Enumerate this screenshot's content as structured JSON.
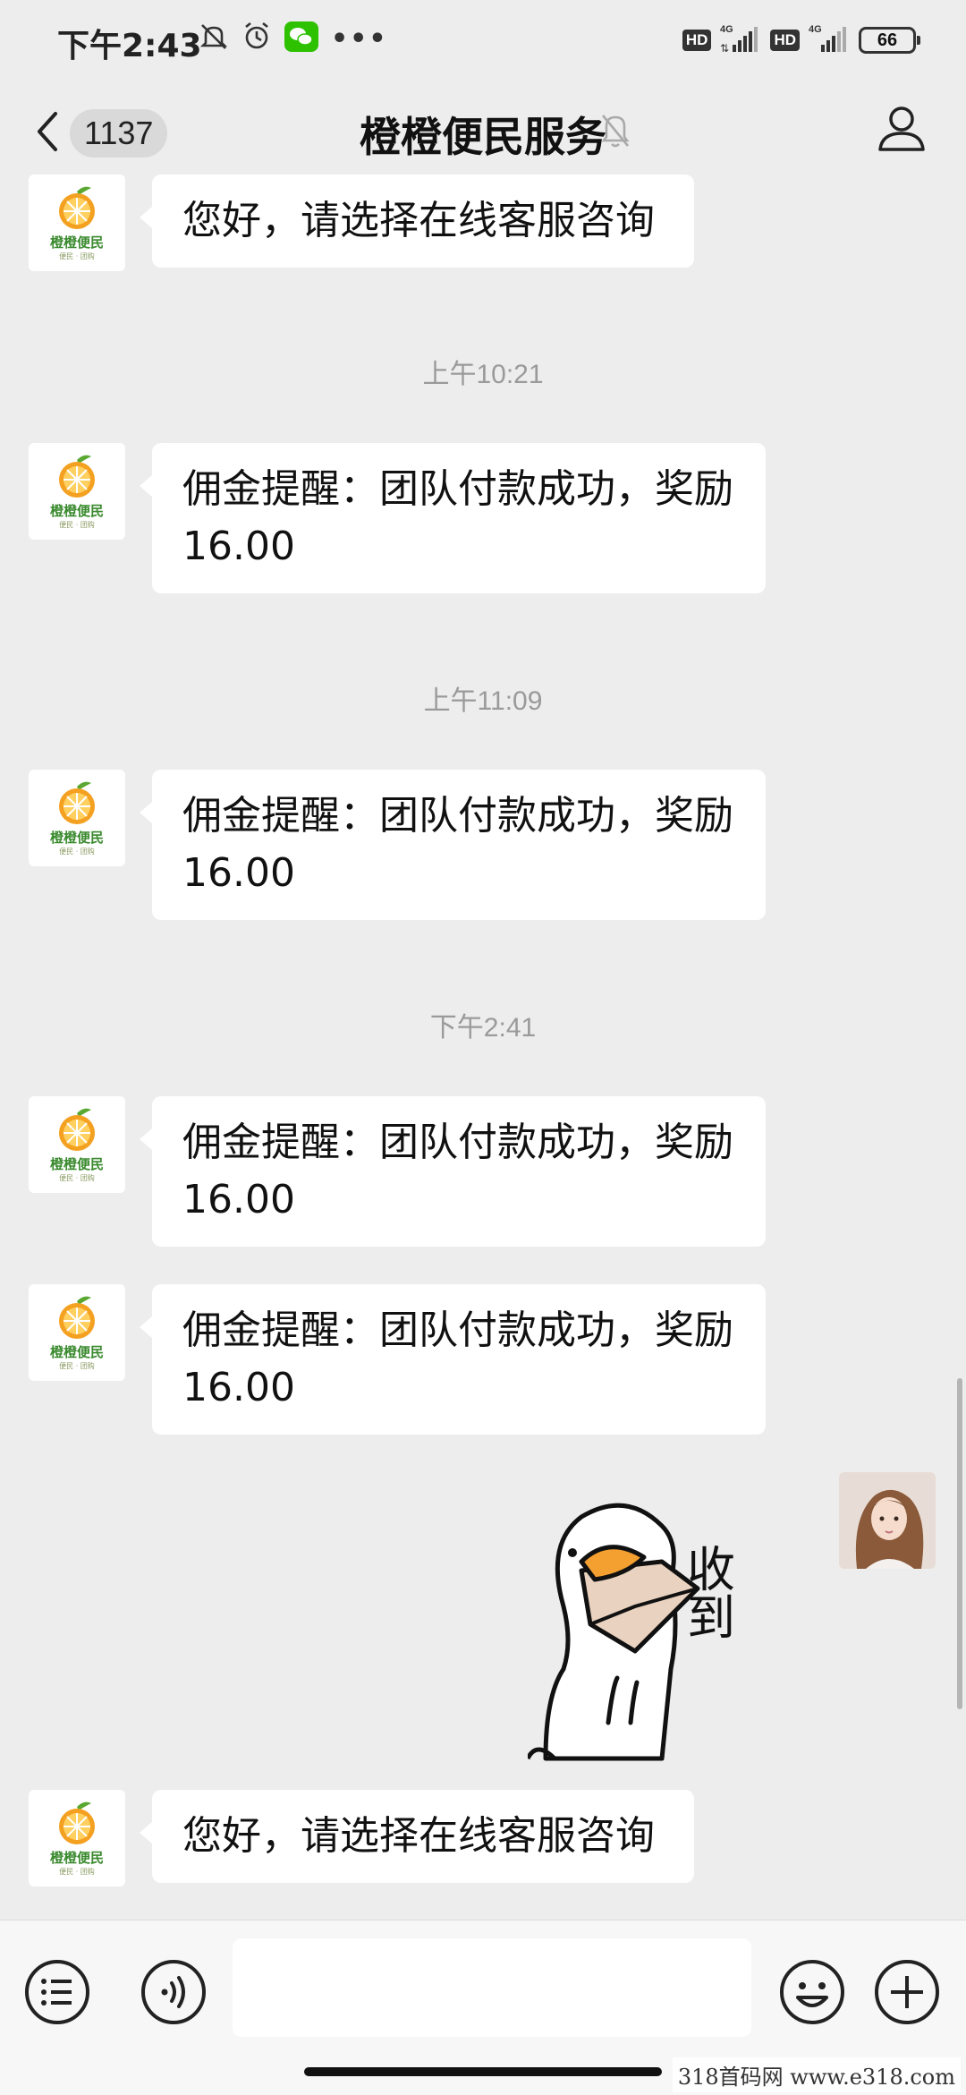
{
  "status_bar": {
    "time": "下午2:43",
    "battery": "66",
    "network": "4G"
  },
  "header": {
    "unread_count": "1137",
    "title": "橙橙便民服务"
  },
  "official_avatar": {
    "brand": "橙橙便民",
    "sub": "便民 · 团购"
  },
  "messages": [
    {
      "text": "您好，请选择在线客服咨询"
    },
    {
      "timestamp": "上午10:21"
    },
    {
      "text_line1": "佣金提醒：团队付款成功，奖励",
      "text_line2": "16.00"
    },
    {
      "timestamp": "上午11:09"
    },
    {
      "text_line1": "佣金提醒：团队付款成功，奖励",
      "text_line2": "16.00"
    },
    {
      "timestamp": "下午2:41"
    },
    {
      "text_line1": "佣金提醒：团队付款成功，奖励",
      "text_line2": "16.00"
    },
    {
      "text_line1": "佣金提醒：团队付款成功，奖励",
      "text_line2": "16.00"
    },
    {
      "sticker_text": "收到"
    },
    {
      "text": "您好，请选择在线客服咨询"
    }
  ],
  "input_bar": {
    "value": ""
  },
  "watermark": "318首码网 www.e318.com"
}
